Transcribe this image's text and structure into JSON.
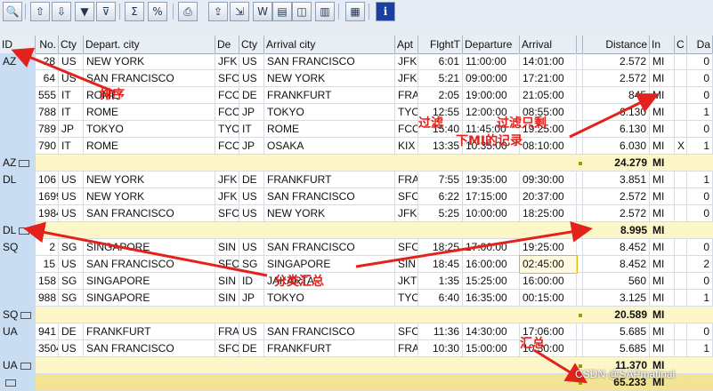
{
  "toolbar": {
    "buttons": [
      {
        "name": "details-icon",
        "glyph": "🔍"
      },
      {
        "name": "sort-ascending-icon",
        "glyph": "⇧"
      },
      {
        "name": "sort-descending-icon",
        "glyph": "⇩"
      },
      {
        "name": "filter-icon",
        "glyph": "▼"
      },
      {
        "name": "delete-filter-icon",
        "glyph": "⊽"
      },
      {
        "name": "sum-icon",
        "glyph": "Σ"
      },
      {
        "name": "subtotal-icon",
        "glyph": "%"
      },
      {
        "name": "print-preview-icon",
        "glyph": "⎙"
      },
      {
        "name": "export-icon",
        "glyph": "⇪"
      },
      {
        "name": "send-icon",
        "glyph": "⇲"
      },
      {
        "name": "word-export-icon",
        "glyph": "W"
      },
      {
        "name": "local-file-icon",
        "glyph": "▤"
      },
      {
        "name": "view-icon",
        "glyph": "◫"
      },
      {
        "name": "graphic-icon",
        "glyph": "▥"
      },
      {
        "name": "layout-icon",
        "glyph": "▦"
      },
      {
        "name": "info-icon",
        "glyph": "i"
      }
    ]
  },
  "columns": [
    "ID",
    "No.",
    "Cty",
    "Depart. city",
    "De",
    "Cty",
    "Arrival city",
    "Apt",
    "FlghtT",
    "Departure",
    "Arrival",
    "",
    "Distance",
    "In",
    "C",
    "Da"
  ],
  "rows": [
    {
      "id": "AZ",
      "no": "28",
      "cty": "US",
      "dep": "NEW YORK",
      "de": "JFK",
      "cty2": "US",
      "arr": "SAN FRANCISCO",
      "apt": "JFK",
      "ft": "6:01",
      "dtime": "11:00:00",
      "atime": "14:01:00",
      "dist": "2.572",
      "in": "MI",
      "c": "",
      "da": "0"
    },
    {
      "id": "",
      "no": "64",
      "cty": "US",
      "dep": "SAN FRANCISCO",
      "de": "SFO",
      "cty2": "US",
      "arr": "NEW YORK",
      "apt": "JFK",
      "ft": "5:21",
      "dtime": "09:00:00",
      "atime": "17:21:00",
      "dist": "2.572",
      "in": "MI",
      "c": "",
      "da": "0"
    },
    {
      "id": "",
      "no": "555",
      "cty": "IT",
      "dep": "ROME",
      "de": "FCO",
      "cty2": "DE",
      "arr": "FRANKFURT",
      "apt": "FRA",
      "ft": "2:05",
      "dtime": "19:00:00",
      "atime": "21:05:00",
      "dist": "845",
      "in": "MI",
      "c": "",
      "da": "0"
    },
    {
      "id": "",
      "no": "788",
      "cty": "IT",
      "dep": "ROME",
      "de": "FCO",
      "cty2": "JP",
      "arr": "TOKYO",
      "apt": "TYO",
      "ft": "12:55",
      "dtime": "12:00:00",
      "atime": "08:55:00",
      "dist": "6.130",
      "in": "MI",
      "c": "",
      "da": "1"
    },
    {
      "id": "",
      "no": "789",
      "cty": "JP",
      "dep": "TOKYO",
      "de": "TYO",
      "cty2": "IT",
      "arr": "ROME",
      "apt": "FCO",
      "ft": "15:40",
      "dtime": "11:45:00",
      "atime": "19:25:00",
      "dist": "6.130",
      "in": "MI",
      "c": "",
      "da": "0"
    },
    {
      "id": "",
      "no": "790",
      "cty": "IT",
      "dep": "ROME",
      "de": "FCO",
      "cty2": "JP",
      "arr": "OSAKA",
      "apt": "KIX",
      "ft": "13:35",
      "dtime": "10:35:00",
      "atime": "08:10:00",
      "dist": "6.030",
      "in": "MI",
      "c": "X",
      "da": "1"
    },
    {
      "sum": true,
      "id": "AZ",
      "dist": "24.279",
      "in": "MI"
    },
    {
      "id": "DL",
      "no": "106",
      "cty": "US",
      "dep": "NEW YORK",
      "de": "JFK",
      "cty2": "DE",
      "arr": "FRANKFURT",
      "apt": "FRA",
      "ft": "7:55",
      "dtime": "19:35:00",
      "atime": "09:30:00",
      "dist": "3.851",
      "in": "MI",
      "c": "",
      "da": "1"
    },
    {
      "id": "",
      "no": "1699",
      "cty": "US",
      "dep": "NEW YORK",
      "de": "JFK",
      "cty2": "US",
      "arr": "SAN FRANCISCO",
      "apt": "SFO",
      "ft": "6:22",
      "dtime": "17:15:00",
      "atime": "20:37:00",
      "dist": "2.572",
      "in": "MI",
      "c": "",
      "da": "0"
    },
    {
      "id": "",
      "no": "1984",
      "cty": "US",
      "dep": "SAN FRANCISCO",
      "de": "SFO",
      "cty2": "US",
      "arr": "NEW YORK",
      "apt": "JFK",
      "ft": "5:25",
      "dtime": "10:00:00",
      "atime": "18:25:00",
      "dist": "2.572",
      "in": "MI",
      "c": "",
      "da": "0"
    },
    {
      "sum": true,
      "id": "DL",
      "dist": "8.995",
      "in": "MI"
    },
    {
      "id": "SQ",
      "no": "2",
      "cty": "SG",
      "dep": "SINGAPORE",
      "de": "SIN",
      "cty2": "US",
      "arr": "SAN FRANCISCO",
      "apt": "SFO",
      "ft": "18:25",
      "dtime": "17:00:00",
      "atime": "19:25:00",
      "dist": "8.452",
      "in": "MI",
      "c": "",
      "da": "0"
    },
    {
      "id": "",
      "no": "15",
      "cty": "US",
      "dep": "SAN FRANCISCO",
      "de": "SFO",
      "cty2": "SG",
      "arr": "SINGAPORE",
      "apt": "SIN",
      "ft": "18:45",
      "dtime": "16:00:00",
      "atime": "02:45:00",
      "dist": "8.452",
      "in": "MI",
      "c": "",
      "da": "2"
    },
    {
      "id": "",
      "no": "158",
      "cty": "SG",
      "dep": "SINGAPORE",
      "de": "SIN",
      "cty2": "ID",
      "arr": "JAKARTA",
      "apt": "JKT",
      "ft": "1:35",
      "dtime": "15:25:00",
      "atime": "16:00:00",
      "dist": "560",
      "in": "MI",
      "c": "",
      "da": "0"
    },
    {
      "id": "",
      "no": "988",
      "cty": "SG",
      "dep": "SINGAPORE",
      "de": "SIN",
      "cty2": "JP",
      "arr": "TOKYO",
      "apt": "TYO",
      "ft": "6:40",
      "dtime": "16:35:00",
      "atime": "00:15:00",
      "dist": "3.125",
      "in": "MI",
      "c": "",
      "da": "1"
    },
    {
      "sum": true,
      "id": "SQ",
      "dist": "20.589",
      "in": "MI"
    },
    {
      "id": "UA",
      "no": "941",
      "cty": "DE",
      "dep": "FRANKFURT",
      "de": "FRA",
      "cty2": "US",
      "arr": "SAN FRANCISCO",
      "apt": "SFO",
      "ft": "11:36",
      "dtime": "14:30:00",
      "atime": "17:06:00",
      "dist": "5.685",
      "in": "MI",
      "c": "",
      "da": "0"
    },
    {
      "id": "",
      "no": "3504",
      "cty": "US",
      "dep": "SAN FRANCISCO",
      "de": "SFO",
      "cty2": "DE",
      "arr": "FRANKFURT",
      "apt": "FRA",
      "ft": "10:30",
      "dtime": "15:00:00",
      "atime": "10:30:00",
      "dist": "5.685",
      "in": "MI",
      "c": "",
      "da": "1"
    },
    {
      "sum": true,
      "id": "UA",
      "dist": "11.370",
      "in": "MI"
    },
    {
      "total": true,
      "dist": "65.233",
      "in": "MI"
    }
  ],
  "annotations": {
    "sort": "排序",
    "filter": "过滤",
    "filter_note_1": "过滤只剩",
    "filter_note_2": "下MI的记录",
    "group": "分类汇总",
    "summary": "汇总"
  },
  "watermark": "CSDN @SAPmatinal"
}
